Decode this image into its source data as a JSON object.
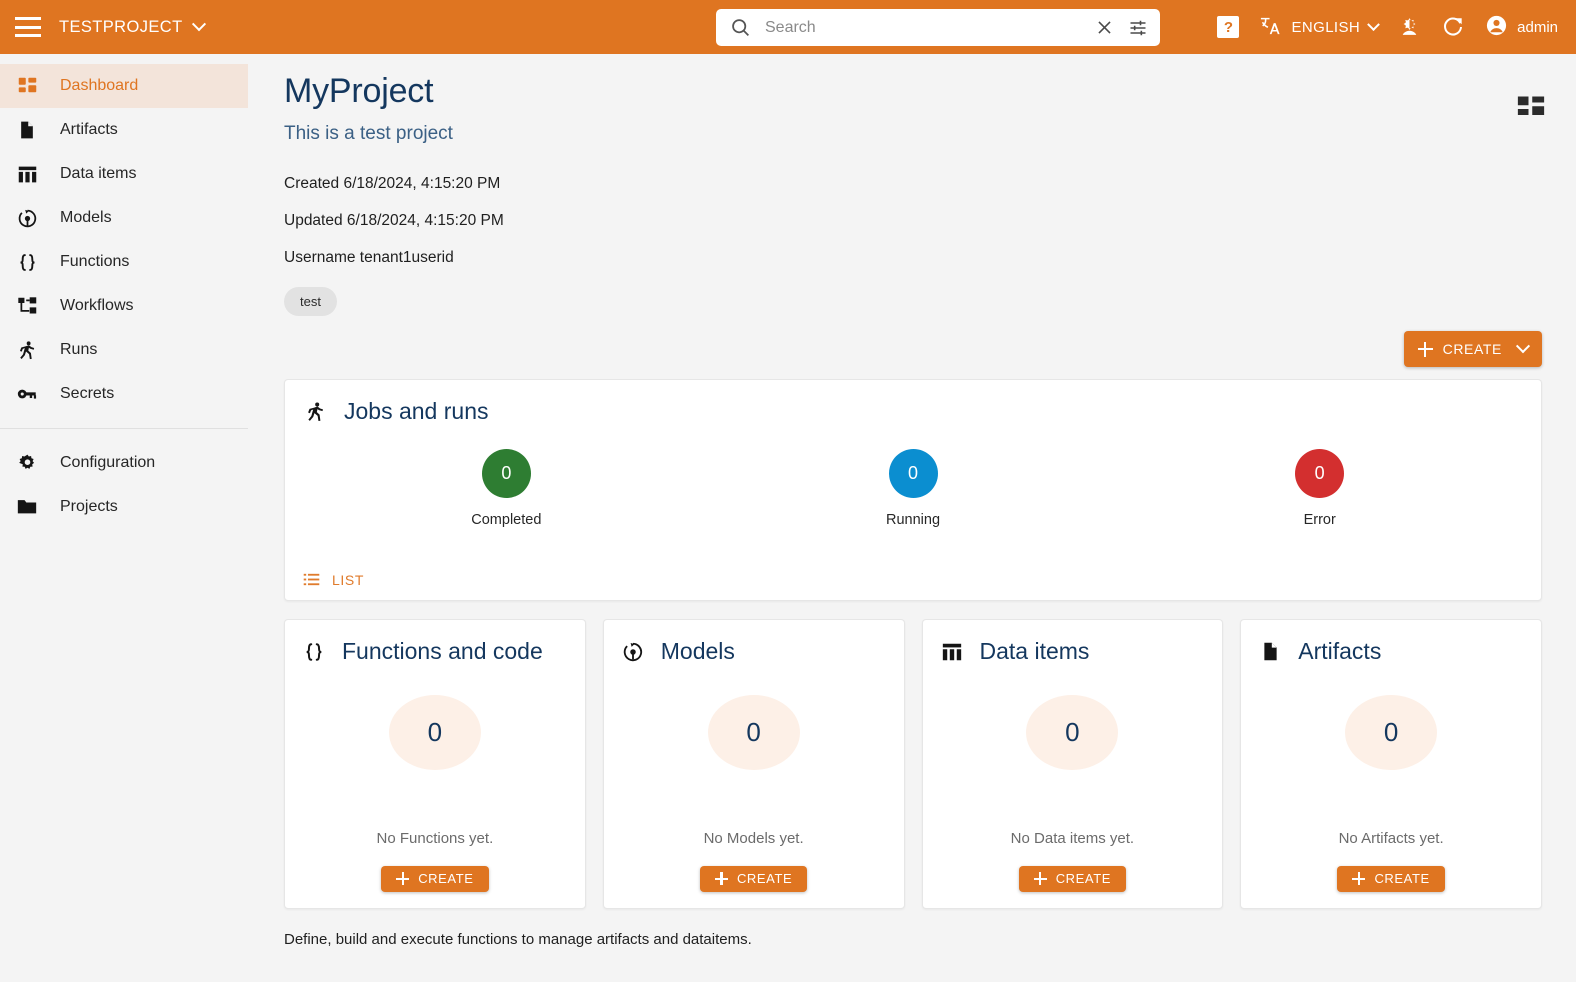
{
  "topbar": {
    "menu_icon": "hamburger-menu-icon",
    "project_name": "TESTPROJECT",
    "search": {
      "placeholder": "Search",
      "value": "",
      "search_icon": "search-icon",
      "clear_icon": "close-icon",
      "filter_icon": "tune-filter-icon"
    },
    "help_label": "?",
    "language": "ENGLISH",
    "theme_icon": "dark-mode-icon",
    "refresh_icon": "refresh-icon",
    "account_icon": "account-circle-icon",
    "username": "admin",
    "bg_color": "#df7521"
  },
  "sidebar": {
    "items": [
      {
        "label": "Dashboard",
        "icon": "dashboard-icon",
        "active": true
      },
      {
        "label": "Artifacts",
        "icon": "file-icon",
        "active": false
      },
      {
        "label": "Data items",
        "icon": "table-icon",
        "active": false
      },
      {
        "label": "Models",
        "icon": "model-icon",
        "active": false
      },
      {
        "label": "Functions",
        "icon": "braces-icon",
        "active": false
      },
      {
        "label": "Workflows",
        "icon": "workflow-icon",
        "active": false
      },
      {
        "label": "Runs",
        "icon": "runner-icon",
        "active": false
      },
      {
        "label": "Secrets",
        "icon": "key-icon",
        "active": false
      }
    ],
    "items_bottom": [
      {
        "label": "Configuration",
        "icon": "gear-icon",
        "active": false
      },
      {
        "label": "Projects",
        "icon": "folder-icon",
        "active": false
      }
    ],
    "active_bg": "#f3e4da",
    "active_color": "#df7521"
  },
  "page": {
    "title": "MyProject",
    "subtitle": "This is a test project",
    "created": "Created 6/18/2024, 4:15:20 PM",
    "updated": "Updated 6/18/2024, 4:15:20 PM",
    "username": "Username tenant1userid",
    "tag": "test",
    "grid_toggle_icon": "grid-view-icon",
    "create_label": "CREATE",
    "footnote": "Define, build and execute functions to manage artifacts and dataitems."
  },
  "jobs_card": {
    "icon": "runner-icon",
    "title": "Jobs and runs",
    "stats": [
      {
        "value": "0",
        "label": "Completed",
        "color": "#2e7d32"
      },
      {
        "value": "0",
        "label": "Running",
        "color": "#0b8ed0"
      },
      {
        "value": "0",
        "label": "Error",
        "color": "#d32f2f"
      }
    ],
    "list_label": "LIST",
    "list_icon": "list-icon"
  },
  "tiles": [
    {
      "icon": "braces-icon",
      "title": "Functions and code",
      "count": "0",
      "empty": "No Functions yet.",
      "create_label": "CREATE"
    },
    {
      "icon": "model-icon",
      "title": "Models",
      "count": "0",
      "empty": "No Models yet.",
      "create_label": "CREATE"
    },
    {
      "icon": "table-icon",
      "title": "Data items",
      "count": "0",
      "empty": "No Data items yet.",
      "create_label": "CREATE"
    },
    {
      "icon": "file-icon",
      "title": "Artifacts",
      "count": "0",
      "empty": "No Artifacts yet.",
      "create_label": "CREATE"
    }
  ]
}
